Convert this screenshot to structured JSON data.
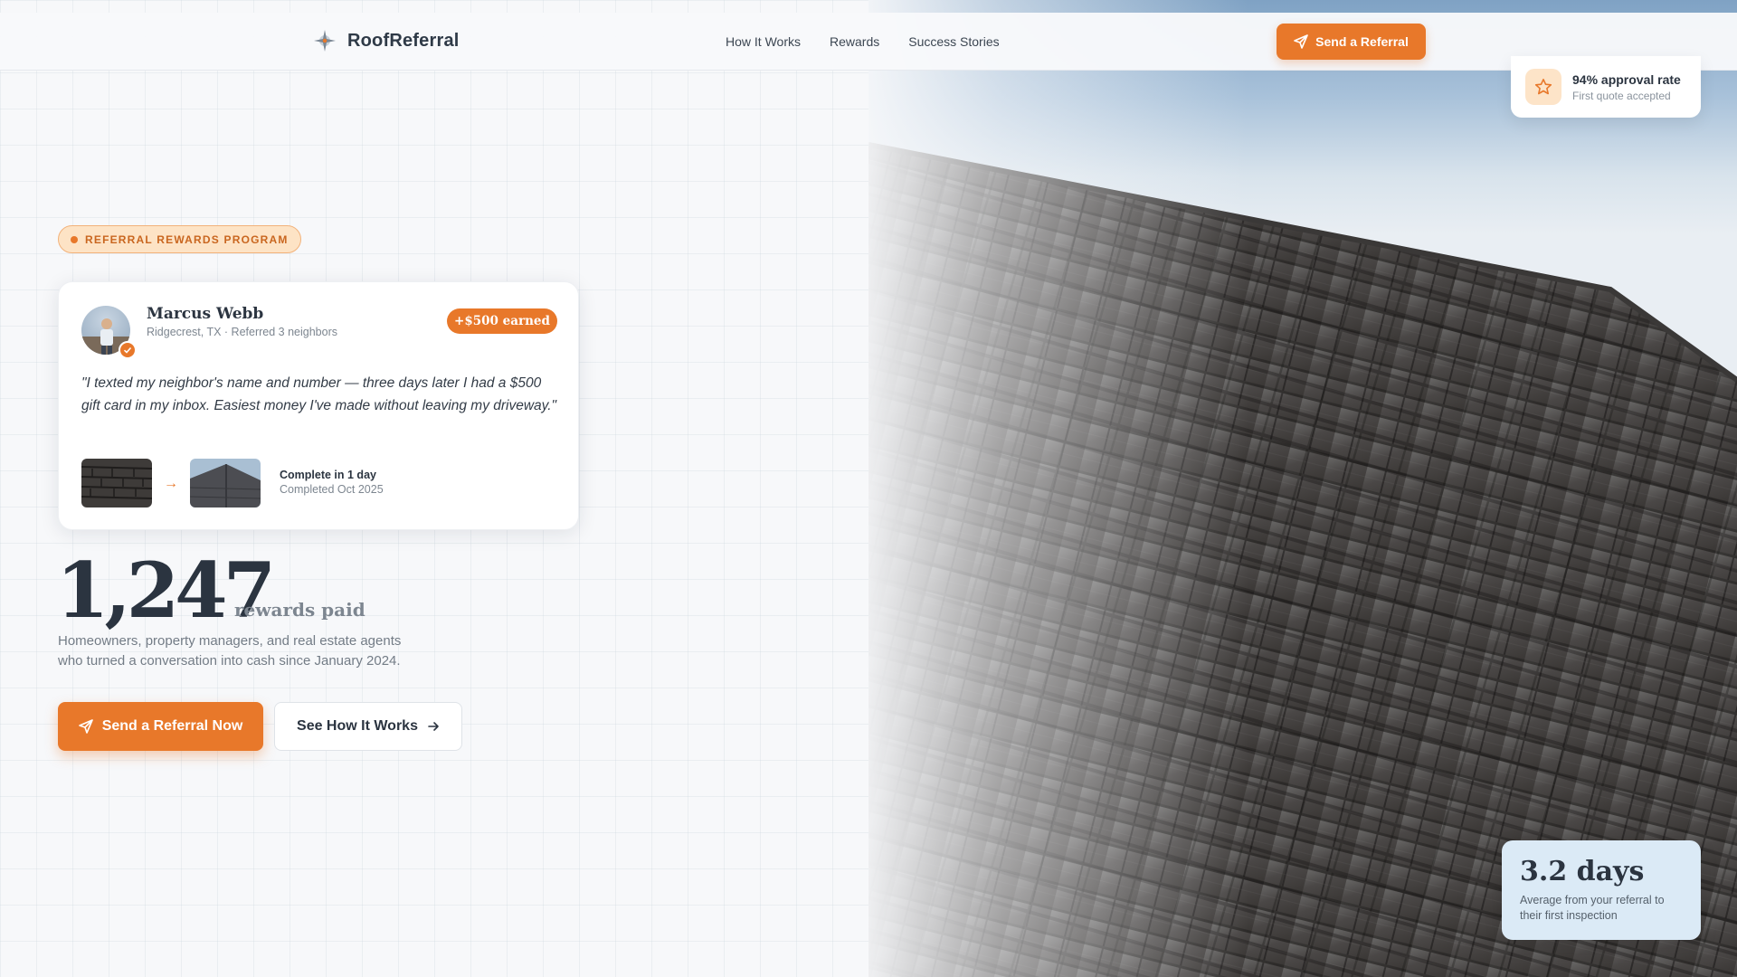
{
  "nav": {
    "brand": "RoofReferral",
    "links": [
      "How It Works",
      "Rewards",
      "Success Stories"
    ],
    "cta_label": "Send a Referral"
  },
  "approval": {
    "title": "94% approval rate",
    "subtitle": "First quote accepted"
  },
  "hero": {
    "badge": "REFERRAL REWARDS PROGRAM",
    "testimonial": {
      "name": "Marcus Webb",
      "meta": "Ridgecrest, TX · Referred 3 neighbors",
      "earned": "+$500 earned",
      "quote": "\"I texted my neighbor's name and number — three days later I had a $500 gift card in my inbox. Easiest money I've made without leaving my driveway.\"",
      "complete": "Complete in 1 day",
      "date": "Completed Oct 2025"
    },
    "stat_number": "1,247",
    "stat_suffix": "rewards paid",
    "stat_desc": "Homeowners, property managers, and real estate agents who turned a conversation into cash since January 2024.",
    "primary_cta": "Send a Referral Now",
    "secondary_cta": "See How It Works"
  },
  "days_card": {
    "value": "3.2 days",
    "desc": "Average from your referral to their first inspection"
  },
  "colors": {
    "accent": "#e8782a",
    "accent_soft": "#fde3c5",
    "text": "#2b3440",
    "muted": "#7d8690",
    "card_blue": "#dbeaf6"
  },
  "icons": {
    "brand": "compass-logo-icon",
    "send": "paper-plane-icon",
    "star": "star-icon",
    "verified": "check-icon",
    "arrow": "arrow-right-icon"
  }
}
